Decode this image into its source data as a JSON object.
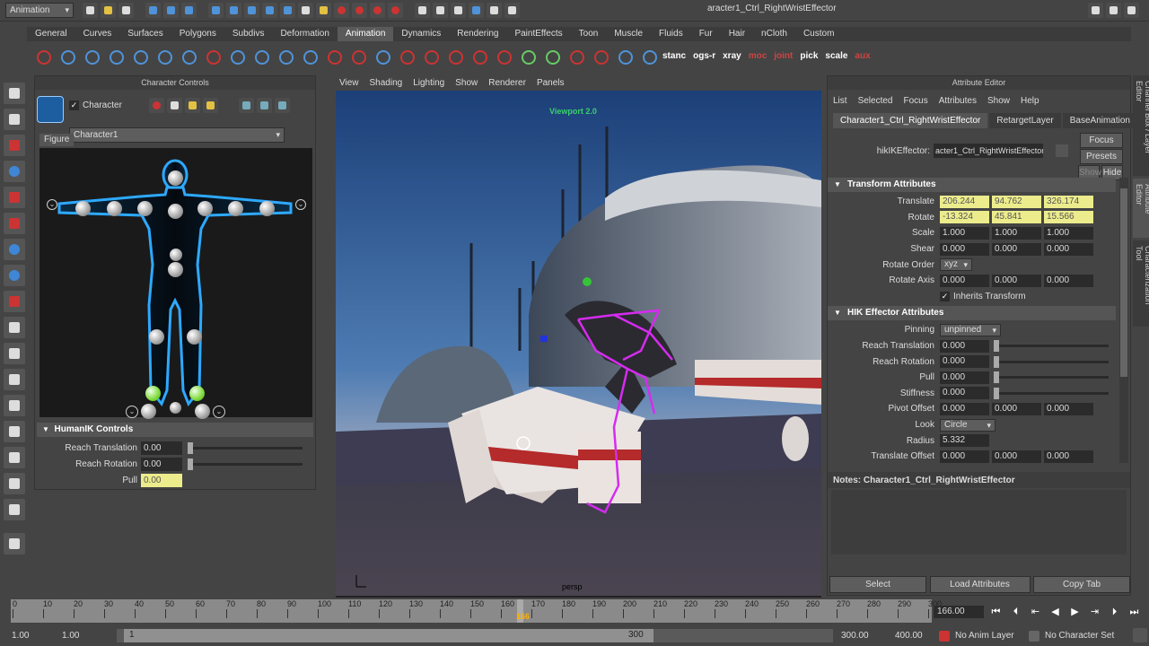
{
  "status_bar": {
    "menu_set": "Animation",
    "selection_field": "aracter1_Ctrl_RightWristEffector"
  },
  "shelf_tabs": [
    "General",
    "Curves",
    "Surfaces",
    "Polygons",
    "Subdivs",
    "Deformation",
    "Animation",
    "Dynamics",
    "Rendering",
    "PaintEffects",
    "Toon",
    "Muscle",
    "Fluids",
    "Fur",
    "Hair",
    "nCloth",
    "Custom"
  ],
  "shelf_active_tab": "Animation",
  "shelf_text_buttons": [
    {
      "label": "stanc",
      "color": "white"
    },
    {
      "label": "ogs-r",
      "color": "white"
    },
    {
      "label": "xray",
      "color": "white"
    },
    {
      "label": "moc",
      "color": "red"
    },
    {
      "label": "joint",
      "color": "red"
    },
    {
      "label": "pick",
      "color": "white"
    },
    {
      "label": "scale",
      "color": "white"
    },
    {
      "label": "aux",
      "color": "red"
    }
  ],
  "character_controls": {
    "title": "Character Controls",
    "character_checkbox_label": "Character",
    "character_select": "Character1",
    "figure_tab": "Figure",
    "humanik_header": "HumanIK Controls",
    "fields": [
      {
        "label": "Reach Translation",
        "value": "0.00"
      },
      {
        "label": "Reach Rotation",
        "value": "0.00"
      },
      {
        "label": "Pull",
        "value": "0.00",
        "highlight": true
      }
    ]
  },
  "viewport": {
    "menu": [
      "View",
      "Shading",
      "Lighting",
      "Show",
      "Renderer",
      "Panels"
    ],
    "hud_title": "Viewport 2.0",
    "camera": "persp"
  },
  "attribute_editor": {
    "title": "Attribute Editor",
    "menu": [
      "List",
      "Selected",
      "Focus",
      "Attributes",
      "Show",
      "Help"
    ],
    "tabs": [
      "Character1_Ctrl_RightWristEffector",
      "RetargetLayer",
      "BaseAnimation"
    ],
    "node_type_label": "hikIKEffector:",
    "node_name": "acter1_Ctrl_RightWristEffector",
    "focus_btn": "Focus",
    "presets_btn": "Presets",
    "show_btn": "Show",
    "hide_btn": "Hide",
    "transform_header": "Transform Attributes",
    "translate": {
      "label": "Translate",
      "values": [
        "206.244",
        "94.762",
        "326.174"
      ]
    },
    "rotate": {
      "label": "Rotate",
      "values": [
        "-13.324",
        "45.841",
        "15.566"
      ]
    },
    "scale": {
      "label": "Scale",
      "values": [
        "1.000",
        "1.000",
        "1.000"
      ]
    },
    "shear": {
      "label": "Shear",
      "values": [
        "0.000",
        "0.000",
        "0.000"
      ]
    },
    "rotate_order": {
      "label": "Rotate Order",
      "value": "xyz"
    },
    "rotate_axis": {
      "label": "Rotate Axis",
      "values": [
        "0.000",
        "0.000",
        "0.000"
      ]
    },
    "inherits": "Inherits Transform",
    "hik_header": "HIK Effector Attributes",
    "pinning": {
      "label": "Pinning",
      "value": "unpinned"
    },
    "reach_t": {
      "label": "Reach Translation",
      "value": "0.000"
    },
    "reach_r": {
      "label": "Reach Rotation",
      "value": "0.000"
    },
    "pull": {
      "label": "Pull",
      "value": "0.000"
    },
    "stiffness": {
      "label": "Stiffness",
      "value": "0.000"
    },
    "pivot_offset": {
      "label": "Pivot Offset",
      "values": [
        "0.000",
        "0.000",
        "0.000"
      ]
    },
    "look": {
      "label": "Look",
      "value": "Circle"
    },
    "radius": {
      "label": "Radius",
      "value": "5.332"
    },
    "translate_offset": {
      "label": "Translate Offset",
      "values": [
        "0.000",
        "0.000",
        "0.000"
      ]
    },
    "notes_label": "Notes:  Character1_Ctrl_RightWristEffector",
    "bottom_buttons": [
      "Select",
      "Load Attributes",
      "Copy Tab"
    ]
  },
  "side_tabs": [
    "Channel Box / Layer Editor",
    "Attribute Editor",
    "Characterization Tool"
  ],
  "time_slider": {
    "ticks": [
      "0",
      "10",
      "20",
      "30",
      "40",
      "50",
      "60",
      "70",
      "80",
      "90",
      "100",
      "110",
      "120",
      "130",
      "140",
      "150",
      "160",
      "170",
      "180",
      "190",
      "200",
      "210",
      "220",
      "230",
      "240",
      "250",
      "260",
      "270",
      "280",
      "290",
      "300"
    ],
    "current_frame_marker": "166",
    "current_frame_field": "166.00"
  },
  "range_slider": {
    "start": "1.00",
    "playback_start": "1.00",
    "range_start_label": "1",
    "range_end_label": "300",
    "playback_end": "300.00",
    "end": "400.00",
    "anim_layer": "No Anim Layer",
    "char_set": "No Character Set"
  }
}
